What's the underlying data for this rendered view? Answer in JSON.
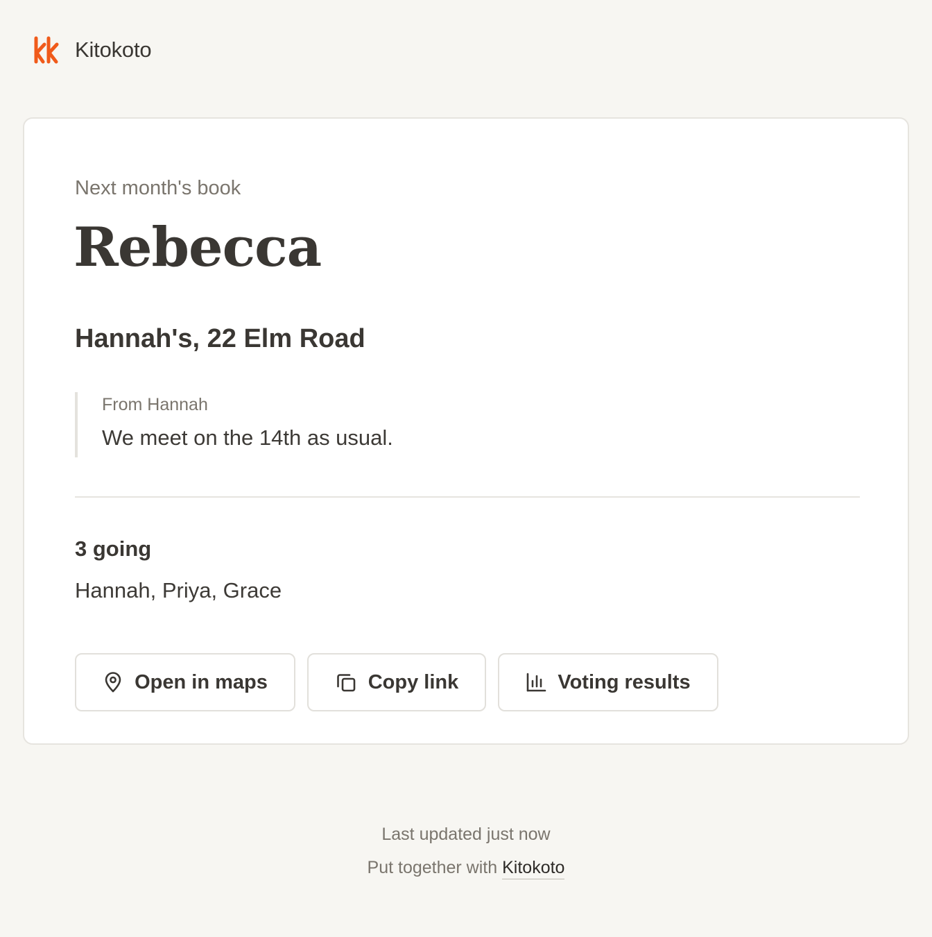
{
  "brand": {
    "name": "Kitokoto",
    "accent_color": "#f05a1a",
    "logo_icon": "kk-logo"
  },
  "event": {
    "eyebrow": "Next month's book",
    "book_title": "Rebecca",
    "location": "Hannah's, 22 Elm Road",
    "note": {
      "from": "From Hannah",
      "text": "We meet on the 14th as usual."
    },
    "attendance": {
      "count_label": "3 going",
      "names": "Hannah, Priya, Grace"
    }
  },
  "actions": {
    "maps": {
      "label": "Open in maps",
      "icon": "map-pin-icon"
    },
    "copy": {
      "label": "Copy link",
      "icon": "copy-icon"
    },
    "vote": {
      "label": "Voting results",
      "icon": "bar-chart-icon"
    }
  },
  "footer": {
    "updated": "Last updated just now",
    "credit_prefix": "Put together with",
    "credit_link": "Kitokoto"
  }
}
